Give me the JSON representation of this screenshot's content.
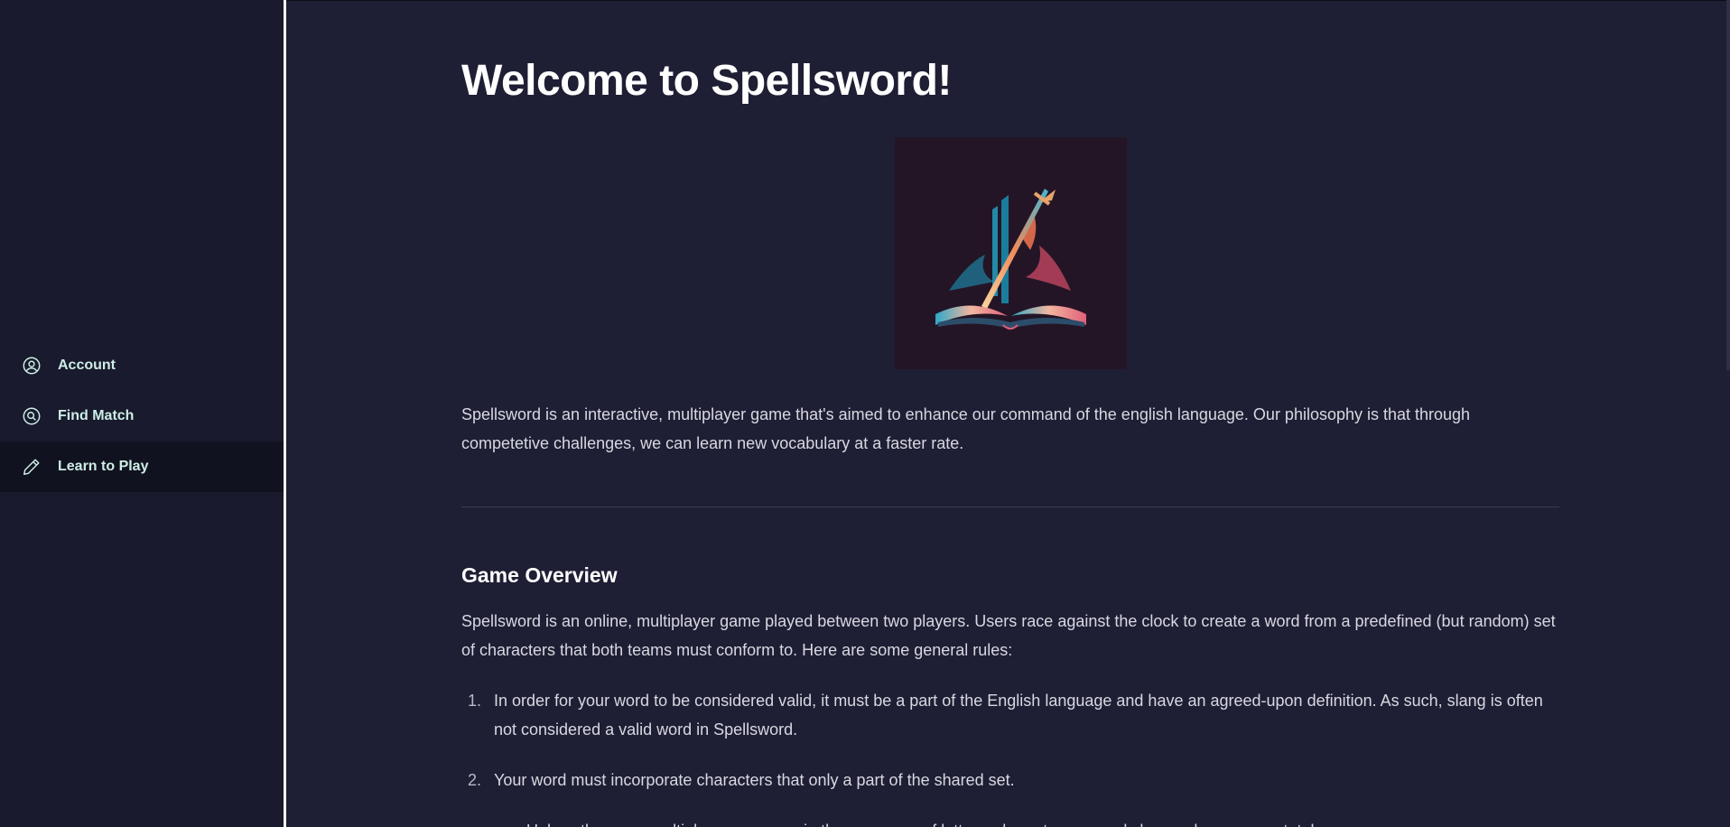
{
  "sidebar": {
    "items": [
      {
        "label": "Account",
        "icon": "user-circle-icon",
        "active": false
      },
      {
        "label": "Find Match",
        "icon": "search-circle-icon",
        "active": false
      },
      {
        "label": "Learn to Play",
        "icon": "pencil-icon",
        "active": true
      }
    ]
  },
  "main": {
    "title": "Welcome to Spellsword!",
    "logo": {
      "icon": "spellsword-book-sword-logo"
    },
    "intro": "Spellsword is an interactive, multiplayer game that's aimed to enhance our command of the english language. Our philosophy is that through competetive challenges, we can learn new vocabulary at a faster rate.",
    "overview_heading": "Game Overview",
    "overview_text": "Spellsword is an online, multiplayer game played between two players. Users race against the clock to create a word from a predefined (but random) set of characters that both teams must conform to. Here are some general rules:",
    "rules": [
      {
        "num": "1.",
        "text": "In order for your word to be considered valid, it must be a part of the English language and have an agreed-upon definition. As such, slang is often not considered a valid word in Spellsword."
      },
      {
        "num": "2.",
        "text": "Your word must incorporate characters that only a part of the shared set."
      }
    ],
    "partial_subrule": "Unless there are multiple occurrences in the sequence of letters, characters can only be used once per a total"
  },
  "colors": {
    "background": "#1e1f34",
    "sidebar": "#191a2d",
    "nav_text": "#cdeee6",
    "active_item": "#111220"
  }
}
